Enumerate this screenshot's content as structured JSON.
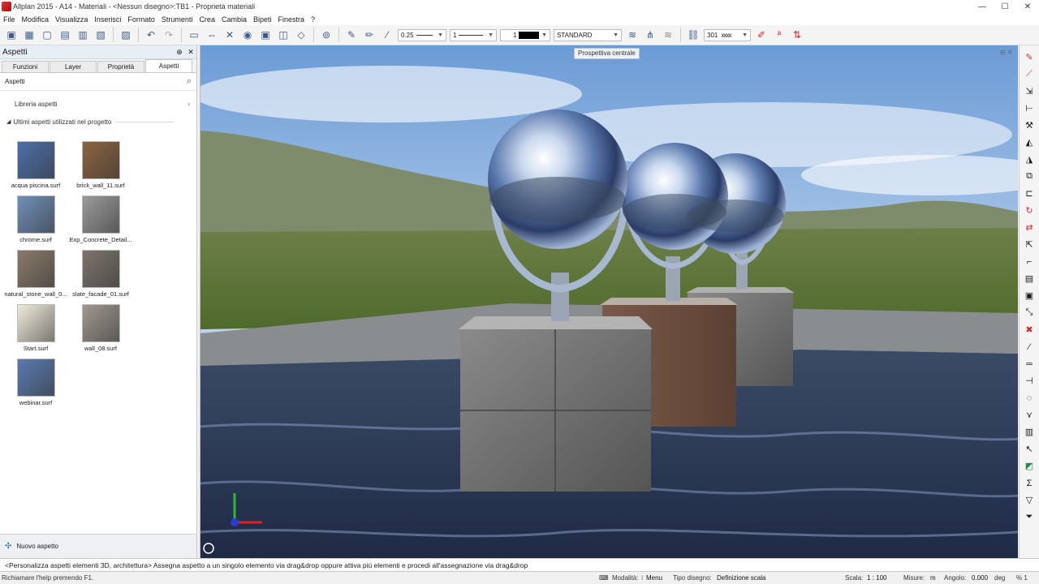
{
  "window": {
    "title": "Allplan 2015 - A14 - Materiali - <Nessun disegno>:TB1 - Proprietà materiali",
    "min": "—",
    "max": "☐",
    "close": "✕"
  },
  "menu": [
    "File",
    "Modifica",
    "Visualizza",
    "Inserisci",
    "Formato",
    "Strumenti",
    "Crea",
    "Cambia",
    "Bipeti",
    "Finestra",
    "?"
  ],
  "toolbar": {
    "pen": "0.25",
    "line": "1",
    "color": "1",
    "layer_std": "STANDARD",
    "pen_no": "301"
  },
  "palette": {
    "title": "Aspetti",
    "pin": "⊕",
    "close": "✕",
    "tabs": [
      "Funzioni",
      "Layer",
      "Proprietà",
      "Aspetti"
    ],
    "section_label": "Aspetti",
    "library": "Libreria aspetti",
    "recent": "Ultimi aspetti utilizzati nel progetto",
    "items": [
      {
        "label": "acqua piscina.surf",
        "color": "#4d6fa8"
      },
      {
        "label": "brick_wall_11.surf",
        "color": "#8a6440"
      },
      {
        "label": "chrome.surf",
        "color": "#6f8fb8"
      },
      {
        "label": "Exp_Concrete_Detail...",
        "color": "#9a9a9a"
      },
      {
        "label": "natural_stone_wall_0...",
        "color": "#8a7a6a"
      },
      {
        "label": "slate_facade_01.surf",
        "color": "#7d756c"
      },
      {
        "label": "Start.surf",
        "color": "#f0ecdc"
      },
      {
        "label": "wall_08.surf",
        "color": "#a09890"
      },
      {
        "label": "webinar.surf",
        "color": "#5a7ab0"
      }
    ],
    "new_label": "Nuovo aspetto"
  },
  "viewport": {
    "tooltip": "Prospettiva centrale"
  },
  "hint": "<Personalizza aspetti elementi 3D, architettura> Assegna aspetto a un singolo elemento via drag&drop oppure attiva più elementi e procedi all'assegnazione via drag&drop",
  "status": {
    "help": "Richiamare l'help premendo F1.",
    "modality_label": "Modalità:",
    "modality_value": "Menu",
    "drawing_type_label": "Tipo disegno:",
    "drawing_type_value": "Definizione scala",
    "scale_label": "Scala:",
    "scale_value": "1 : 100",
    "measure_label": "Misure:",
    "measure_value": "m",
    "angle_label": "Angolo:",
    "angle_value": "0.000",
    "angle_unit": "deg",
    "percent": "% 1"
  }
}
